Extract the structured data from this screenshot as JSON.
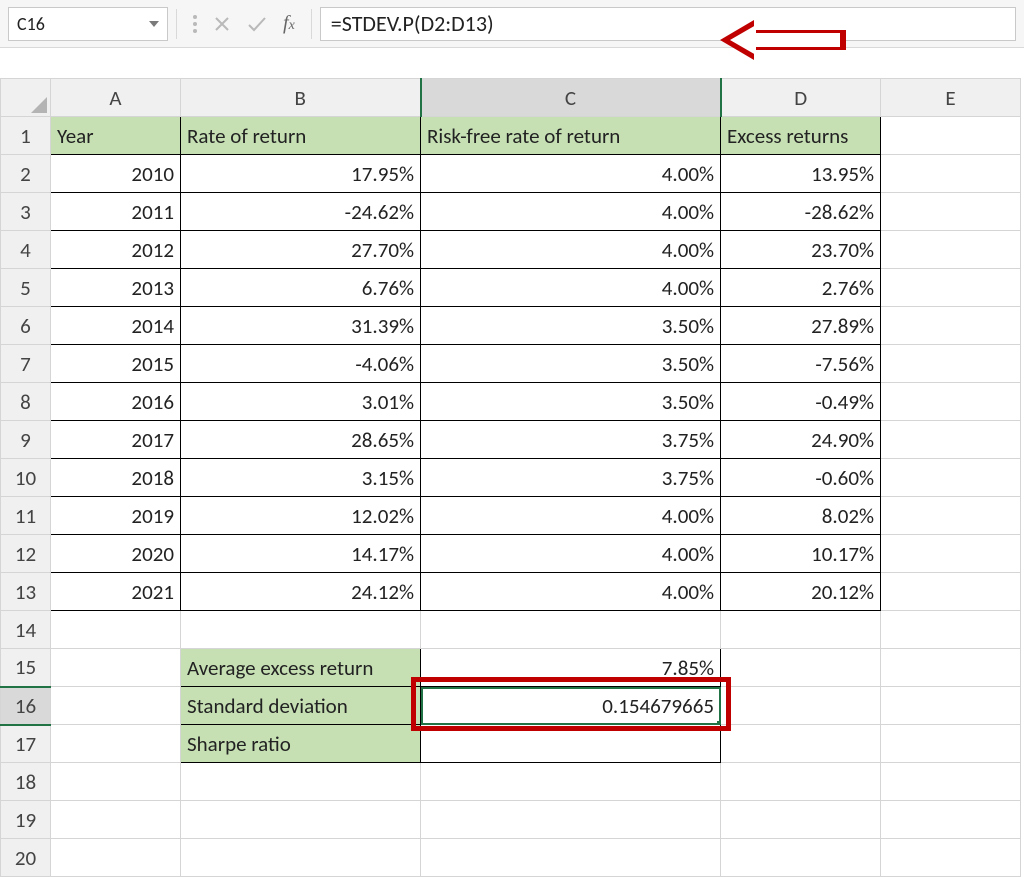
{
  "formulaBar": {
    "cellRef": "C16",
    "formula": "=STDEV.P(D2:D13)"
  },
  "columns": [
    "A",
    "B",
    "C",
    "D",
    "E"
  ],
  "headerRow": {
    "A": "Year",
    "B": "Rate of return",
    "C": "Risk-free rate of return",
    "D": "Excess returns"
  },
  "dataRows": [
    {
      "A": "2010",
      "B": "17.95%",
      "C": "4.00%",
      "D": "13.95%"
    },
    {
      "A": "2011",
      "B": "-24.62%",
      "C": "4.00%",
      "D": "-28.62%"
    },
    {
      "A": "2012",
      "B": "27.70%",
      "C": "4.00%",
      "D": "23.70%"
    },
    {
      "A": "2013",
      "B": "6.76%",
      "C": "4.00%",
      "D": "2.76%"
    },
    {
      "A": "2014",
      "B": "31.39%",
      "C": "3.50%",
      "D": "27.89%"
    },
    {
      "A": "2015",
      "B": "-4.06%",
      "C": "3.50%",
      "D": "-7.56%"
    },
    {
      "A": "2016",
      "B": "3.01%",
      "C": "3.50%",
      "D": "-0.49%"
    },
    {
      "A": "2017",
      "B": "28.65%",
      "C": "3.75%",
      "D": "24.90%"
    },
    {
      "A": "2018",
      "B": "3.15%",
      "C": "3.75%",
      "D": "-0.60%"
    },
    {
      "A": "2019",
      "B": "12.02%",
      "C": "4.00%",
      "D": "8.02%"
    },
    {
      "A": "2020",
      "B": "14.17%",
      "C": "4.00%",
      "D": "10.17%"
    },
    {
      "A": "2021",
      "B": "24.12%",
      "C": "4.00%",
      "D": "20.12%"
    }
  ],
  "summary": [
    {
      "label": "Average excess return",
      "value": "7.85%"
    },
    {
      "label": "Standard deviation",
      "value": "0.154679665"
    },
    {
      "label": "Sharpe ratio",
      "value": ""
    }
  ],
  "rowNumbers": 20,
  "activeCell": {
    "row": 16,
    "col": "C"
  }
}
